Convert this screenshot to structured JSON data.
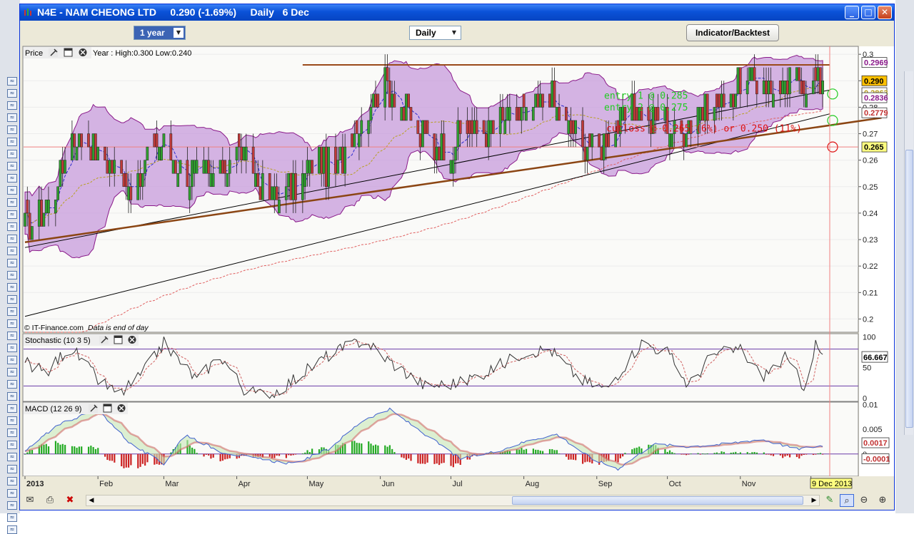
{
  "window": {
    "title": "N4E - NAM CHEONG LTD     0.290 (-1.69%)     Daily   6 Dec"
  },
  "toolbar": {
    "period_label": "1 year",
    "interval_label": "Daily",
    "indicator_button_label": "Indicator/Backtest"
  },
  "price_panel": {
    "label": "Price",
    "range_text": "Year : High:0.300 Low:0.240",
    "watermark": "© IT-Finance.com",
    "watermark_note": "Data is end of day",
    "tags": [
      {
        "text": "0.2969",
        "value": 0.2969,
        "color": "#8a1a8a",
        "bg": "#ffffff"
      },
      {
        "text": "0.290",
        "value": 0.29,
        "color": "#000000",
        "bg": "#ffc000"
      },
      {
        "text": "0.2863",
        "value": 0.2855,
        "color": "#b8a020",
        "bg": "#ffffff"
      },
      {
        "text": "0.2836",
        "value": 0.2836,
        "color": "#8a1a8a",
        "bg": "#ffffff"
      },
      {
        "text": "0.2779",
        "value": 0.2779,
        "color": "#c03030",
        "bg": "#ffffff"
      },
      {
        "text": "0.265",
        "value": 0.265,
        "color": "#000000",
        "bg": "#ffff80"
      }
    ],
    "annotations": [
      {
        "text": "entry 1 @ 0.285",
        "color": "#22cc22"
      },
      {
        "text": "entry 2 @ 0.275",
        "color": "#22cc22"
      },
      {
        "text": "cutloss @ 0.265 (6%) or 0.250 (11%)",
        "color": "#dd1111"
      }
    ]
  },
  "stoch_panel": {
    "label": "Stochastic (10 3 5)",
    "ticks": [
      "100",
      "50",
      "0"
    ],
    "value_tag": "66.667"
  },
  "macd_panel": {
    "label": "MACD (12 26 9)",
    "ticks": [
      "0.01",
      "0.005",
      "0"
    ],
    "tags": [
      {
        "text": "0.0017",
        "value": 0.0017,
        "color": "#c03030"
      },
      {
        "text": "-0.0001",
        "value": -0.0001,
        "color": "#c03030"
      }
    ]
  },
  "xaxis": {
    "months": [
      {
        "label": "2013",
        "bold": true
      },
      {
        "label": "Feb",
        "bold": false
      },
      {
        "label": "Mar",
        "bold": false
      },
      {
        "label": "Apr",
        "bold": false
      },
      {
        "label": "May",
        "bold": false
      },
      {
        "label": "Jun",
        "bold": false
      },
      {
        "label": "Jul",
        "bold": false
      },
      {
        "label": "Aug",
        "bold": false
      },
      {
        "label": "Sep",
        "bold": false
      },
      {
        "label": "Oct",
        "bold": false
      },
      {
        "label": "Nov",
        "bold": false
      },
      {
        "label": "D",
        "bold": false
      }
    ],
    "current_date_tag": "9 Dec 2013"
  },
  "colors": {
    "up_candle": "#2fa02f",
    "down_candle": "#c03a3a",
    "bollinger_fill": "#c79bdc",
    "bollinger_line": "#8a1a8a",
    "resistance": "#9a4a1a",
    "support": "#8b4513",
    "ma_short": "#2b2bcf",
    "ma_mid": "#b8a020",
    "ma_long": "#e06060",
    "stoch_k": "#333333",
    "stoch_d": "#d06060",
    "macd_line": "#4060d0",
    "macd_signal": "#d06060",
    "macd_hist_pos": "#22aa22",
    "macd_hist_neg": "#cc2222"
  },
  "chart_data": [
    {
      "type": "candlestick",
      "title": "N4E - NAM CHEONG LTD",
      "ylim": [
        0.195,
        0.303
      ],
      "yticks": [
        0.2,
        0.21,
        0.22,
        0.23,
        0.24,
        0.25,
        0.26,
        0.27,
        0.28,
        0.29,
        0.3
      ],
      "ytick_labels": [
        "0.2",
        "0.21",
        "0.22",
        "0.23",
        "0.24",
        "0.25",
        "0.26",
        "0.27",
        "0.28",
        "0.29",
        "0.3"
      ],
      "x_range": [
        "2013-01-01",
        "2013-12-09"
      ],
      "months": [
        "2013-01-01",
        "2013-02-01",
        "2013-03-01",
        "2013-04-01",
        "2013-05-01",
        "2013-06-01",
        "2013-07-01",
        "2013-08-01",
        "2013-09-01",
        "2013-10-01",
        "2013-11-01",
        "2013-12-01"
      ],
      "close_path": [
        [
          "2013-01-01",
          0.236
        ],
        [
          "2013-01-07",
          0.24
        ],
        [
          "2013-01-14",
          0.25
        ],
        [
          "2013-01-21",
          0.27
        ],
        [
          "2013-01-28",
          0.265
        ],
        [
          "2013-02-04",
          0.262
        ],
        [
          "2013-02-11",
          0.255
        ],
        [
          "2013-02-18",
          0.25
        ],
        [
          "2013-02-25",
          0.27
        ],
        [
          "2013-03-04",
          0.26
        ],
        [
          "2013-03-11",
          0.255
        ],
        [
          "2013-03-18",
          0.255
        ],
        [
          "2013-03-25",
          0.255
        ],
        [
          "2013-04-01",
          0.265
        ],
        [
          "2013-04-08",
          0.255
        ],
        [
          "2013-04-15",
          0.248
        ],
        [
          "2013-04-22",
          0.248
        ],
        [
          "2013-04-29",
          0.255
        ],
        [
          "2013-05-06",
          0.26
        ],
        [
          "2013-05-13",
          0.255
        ],
        [
          "2013-05-20",
          0.27
        ],
        [
          "2013-05-27",
          0.28
        ],
        [
          "2013-06-03",
          0.29
        ],
        [
          "2013-06-10",
          0.28
        ],
        [
          "2013-06-17",
          0.27
        ],
        [
          "2013-06-24",
          0.265
        ],
        [
          "2013-07-01",
          0.265
        ],
        [
          "2013-07-08",
          0.27
        ],
        [
          "2013-07-15",
          0.27
        ],
        [
          "2013-07-22",
          0.275
        ],
        [
          "2013-07-29",
          0.275
        ],
        [
          "2013-08-05",
          0.28
        ],
        [
          "2013-08-12",
          0.285
        ],
        [
          "2013-08-19",
          0.275
        ],
        [
          "2013-08-26",
          0.265
        ],
        [
          "2013-09-02",
          0.265
        ],
        [
          "2013-09-09",
          0.27
        ],
        [
          "2013-09-16",
          0.28
        ],
        [
          "2013-09-23",
          0.275
        ],
        [
          "2013-09-30",
          0.275
        ],
        [
          "2013-10-07",
          0.27
        ],
        [
          "2013-10-14",
          0.28
        ],
        [
          "2013-10-21",
          0.28
        ],
        [
          "2013-10-28",
          0.285
        ],
        [
          "2013-11-04",
          0.29
        ],
        [
          "2013-11-11",
          0.29
        ],
        [
          "2013-11-18",
          0.285
        ],
        [
          "2013-11-25",
          0.29
        ],
        [
          "2013-12-02",
          0.29
        ],
        [
          "2013-12-06",
          0.29
        ]
      ],
      "resistance_line": {
        "from": [
          "2013-04-29",
          0.296
        ],
        "to": [
          "2013-12-09",
          0.296
        ]
      },
      "support_line": {
        "from": [
          "2013-01-01",
          0.229
        ],
        "to": [
          "2013-12-31",
          0.276
        ]
      },
      "upper_channel": {
        "from": [
          "2013-01-01",
          0.227
        ],
        "to": [
          "2013-12-09",
          0.2865
        ]
      },
      "lower_channel": {
        "from": [
          "2013-01-01",
          0.201
        ],
        "to": [
          "2013-12-09",
          0.2775
        ]
      },
      "markers": [
        {
          "date": "2013-12-09",
          "value": 0.285,
          "color": "#22cc22"
        },
        {
          "date": "2013-12-09",
          "value": 0.275,
          "color": "#22cc22"
        },
        {
          "date": "2013-12-09",
          "value": 0.265,
          "color": "#dd1111"
        }
      ],
      "cutloss_line": 0.265
    },
    {
      "type": "line",
      "title": "Stochastic (10 3 5)",
      "ylim": [
        -5,
        105
      ],
      "yticks": [
        0,
        50,
        100
      ],
      "levels": [
        20,
        80
      ],
      "k_path": [
        [
          "2013-01-01",
          60
        ],
        [
          "2013-01-10",
          40
        ],
        [
          "2013-01-20",
          85
        ],
        [
          "2013-02-01",
          30
        ],
        [
          "2013-02-10",
          5
        ],
        [
          "2013-02-20",
          40
        ],
        [
          "2013-03-01",
          90
        ],
        [
          "2013-03-15",
          30
        ],
        [
          "2013-03-25",
          70
        ],
        [
          "2013-04-05",
          10
        ],
        [
          "2013-04-15",
          5
        ],
        [
          "2013-04-25",
          30
        ],
        [
          "2013-05-10",
          70
        ],
        [
          "2013-05-25",
          95
        ],
        [
          "2013-06-05",
          60
        ],
        [
          "2013-06-20",
          20
        ],
        [
          "2013-07-05",
          25
        ],
        [
          "2013-07-20",
          50
        ],
        [
          "2013-08-01",
          75
        ],
        [
          "2013-08-12",
          80
        ],
        [
          "2013-08-25",
          30
        ],
        [
          "2013-09-05",
          15
        ],
        [
          "2013-09-20",
          90
        ],
        [
          "2013-10-01",
          75
        ],
        [
          "2013-10-10",
          20
        ],
        [
          "2013-10-20",
          70
        ],
        [
          "2013-11-01",
          80
        ],
        [
          "2013-11-10",
          35
        ],
        [
          "2013-11-20",
          65
        ],
        [
          "2013-11-28",
          20
        ],
        [
          "2013-12-03",
          85
        ],
        [
          "2013-12-06",
          67
        ]
      ]
    },
    {
      "type": "line",
      "title": "MACD (12 26 9)",
      "ylim": [
        -0.0045,
        0.0105
      ],
      "yticks": [
        0,
        0.005,
        0.01
      ],
      "macd_path": [
        [
          "2013-01-01",
          0.0005
        ],
        [
          "2013-01-15",
          0.006
        ],
        [
          "2013-02-01",
          0.009
        ],
        [
          "2013-02-15",
          0.002
        ],
        [
          "2013-03-01",
          -0.002
        ],
        [
          "2013-03-10",
          0.004
        ],
        [
          "2013-03-25",
          0.0005
        ],
        [
          "2013-04-10",
          -0.001
        ],
        [
          "2013-04-25",
          -0.002
        ],
        [
          "2013-05-10",
          0.001
        ],
        [
          "2013-05-25",
          0.007
        ],
        [
          "2013-06-05",
          0.009
        ],
        [
          "2013-06-20",
          0.004
        ],
        [
          "2013-07-05",
          -0.001
        ],
        [
          "2013-07-20",
          0.0005
        ],
        [
          "2013-08-05",
          0.003
        ],
        [
          "2013-08-15",
          0.004
        ],
        [
          "2013-08-30",
          -0.001
        ],
        [
          "2013-09-10",
          -0.003
        ],
        [
          "2013-09-25",
          0.002
        ],
        [
          "2013-10-10",
          0.0015
        ],
        [
          "2013-10-25",
          0.002
        ],
        [
          "2013-11-10",
          0.003
        ],
        [
          "2013-11-25",
          0.001
        ],
        [
          "2013-12-06",
          0.0017
        ]
      ]
    }
  ]
}
